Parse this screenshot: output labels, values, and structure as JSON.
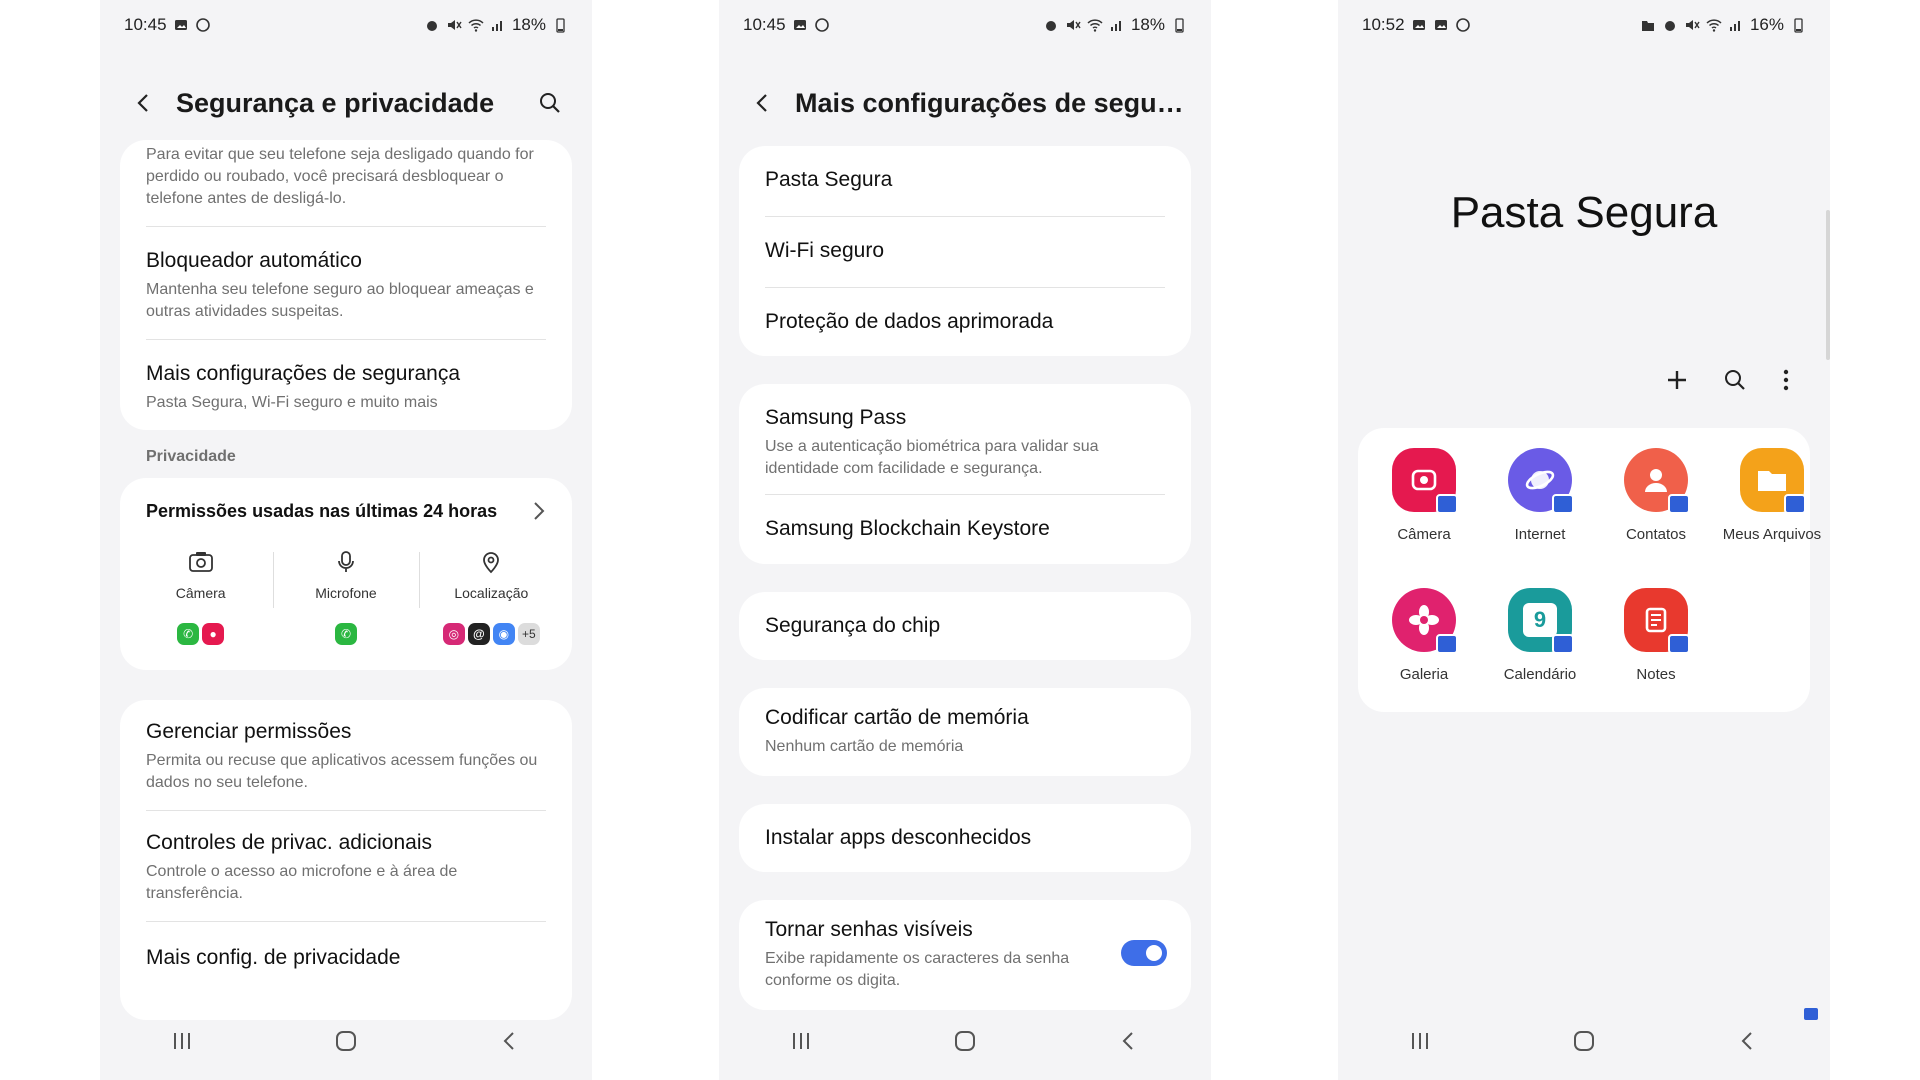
{
  "screens": [
    {
      "status": {
        "time": "10:45",
        "battery": "18%"
      },
      "header": {
        "title": "Segurança e privacidade"
      },
      "intro_text": "Para evitar que seu telefone seja desligado quando for perdido ou roubado, você precisará desbloquear o telefone antes de desligá-lo.",
      "items": [
        {
          "title": "Bloqueador automático",
          "subtitle": "Mantenha seu telefone seguro ao bloquear ameaças e outras atividades suspeitas."
        },
        {
          "title": "Mais configurações de segurança",
          "subtitle": "Pasta Segura, Wi-Fi seguro e muito mais"
        }
      ],
      "privacy_section": "Privacidade",
      "permissions": {
        "title": "Permissões usadas nas últimas 24 horas",
        "columns": [
          {
            "label": "Câmera",
            "icon": "camera-icon"
          },
          {
            "label": "Microfone",
            "icon": "microphone-icon"
          },
          {
            "label": "Localização",
            "icon": "location-icon"
          }
        ],
        "more_count": "+5"
      },
      "privacy_items": [
        {
          "title": "Gerenciar permissões",
          "subtitle": "Permita ou recuse que aplicativos acessem funções ou dados no seu telefone."
        },
        {
          "title": "Controles de privac. adicionais",
          "subtitle": "Controle o acesso ao microfone e à área de transferência."
        },
        {
          "title": "Mais config. de privacidade",
          "subtitle": ""
        }
      ]
    },
    {
      "status": {
        "time": "10:45",
        "battery": "18%"
      },
      "header": {
        "title": "Mais configurações de segur..."
      },
      "group1": [
        "Pasta Segura",
        "Wi-Fi seguro",
        "Proteção de dados aprimorada"
      ],
      "samsung_pass": {
        "title": "Samsung Pass",
        "subtitle": "Use a autenticação biométrica para validar sua identidade com facilidade e segurança."
      },
      "blockchain": "Samsung Blockchain Keystore",
      "chip": "Segurança do chip",
      "memory_card": {
        "title": "Codificar cartão de memória",
        "subtitle": "Nenhum cartão de memória"
      },
      "install_apps": "Instalar apps desconhecidos",
      "passwords": {
        "title": "Tornar senhas visíveis",
        "subtitle": "Exibe rapidamente os caracteres da senha conforme os digita.",
        "enabled": true
      }
    },
    {
      "status": {
        "time": "10:52",
        "battery": "16%"
      },
      "title": "Pasta Segura",
      "apps": [
        {
          "name": "Câmera",
          "color": "#e5194f"
        },
        {
          "name": "Internet",
          "color": "#6a5be6"
        },
        {
          "name": "Contatos",
          "color": "#f0604a"
        },
        {
          "name": "Meus Arquivos",
          "color": "#f4a21a"
        },
        {
          "name": "Galeria",
          "color": "#e0226e"
        },
        {
          "name": "Calendário",
          "color": "#1a9b9b"
        },
        {
          "name": "Notes",
          "color": "#e8392e"
        }
      ],
      "calendar_day": "9"
    }
  ],
  "colors": {
    "accent": "#3e6ee8",
    "background": "#f4f4f6",
    "card": "#ffffff"
  }
}
